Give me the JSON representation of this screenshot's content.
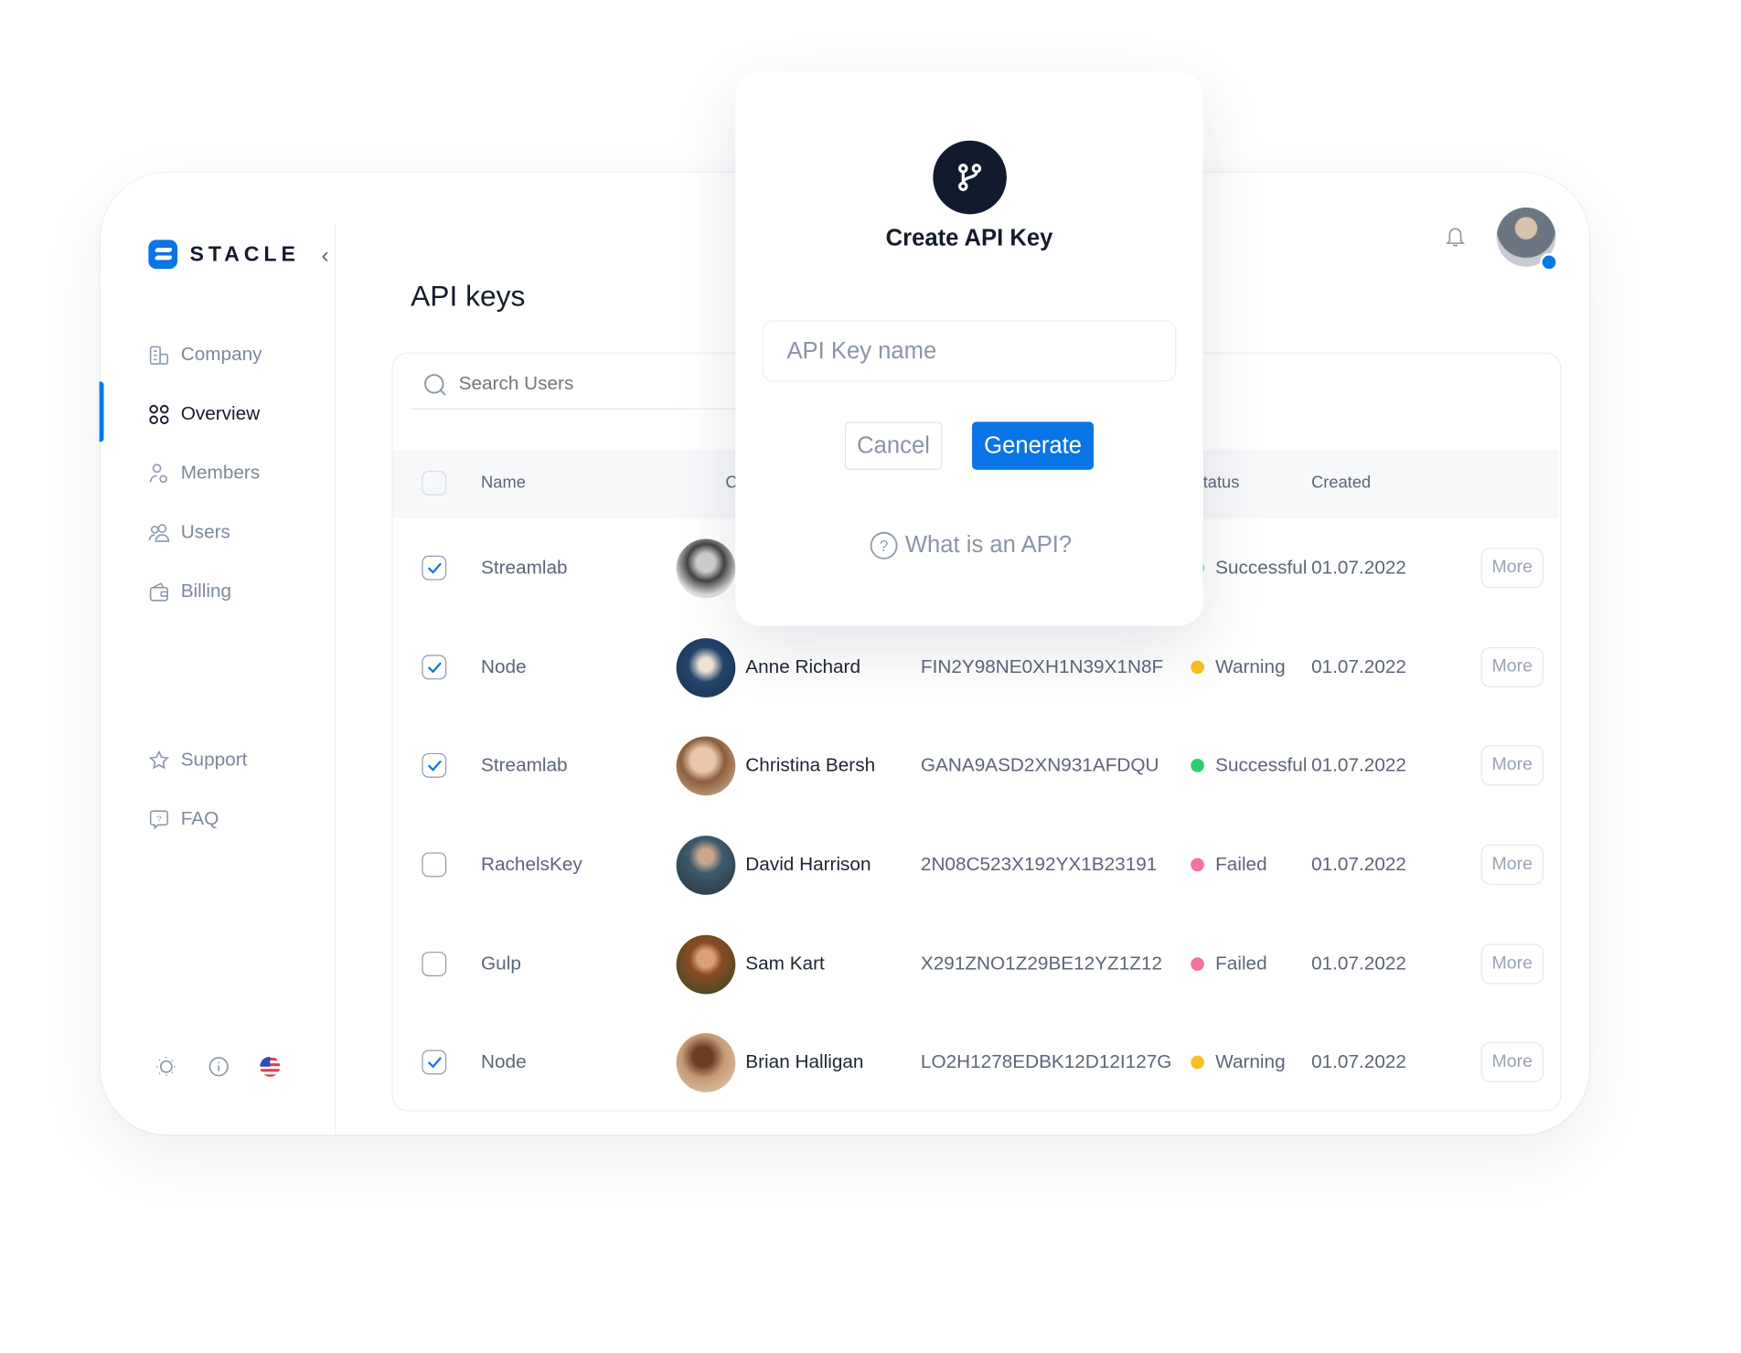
{
  "brand": {
    "name": "STACLE",
    "accent": "#0a75e6"
  },
  "sidebar": {
    "items": [
      {
        "label": "Company",
        "icon": "building-icon",
        "active": false
      },
      {
        "label": "Overview",
        "icon": "grid-icon",
        "active": true
      },
      {
        "label": "Members",
        "icon": "member-settings-icon",
        "active": false
      },
      {
        "label": "Users",
        "icon": "users-icon",
        "active": false
      },
      {
        "label": "Billing",
        "icon": "wallet-icon",
        "active": false
      }
    ],
    "secondary": [
      {
        "label": "Support",
        "icon": "star-icon"
      },
      {
        "label": "FAQ",
        "icon": "question-bubble-icon"
      }
    ],
    "footer_icons": [
      "sun-icon",
      "info-icon",
      "us-flag-icon"
    ]
  },
  "page": {
    "title": "API keys"
  },
  "header": {
    "icons": [
      "bell-icon",
      "avatar"
    ]
  },
  "search": {
    "placeholder": "Search Users"
  },
  "table": {
    "columns": {
      "name": "Name",
      "c": "C",
      "status": "Status",
      "created": "Created"
    },
    "rows": [
      {
        "checked": true,
        "name": "Streamlab",
        "owner": "",
        "key": "",
        "status": "Successful",
        "status_color": "#2ecc71",
        "created": "01.07.2022",
        "action": "More"
      },
      {
        "checked": true,
        "name": "Node",
        "owner": "Anne Richard",
        "key": "FIN2Y98NE0XH1N39X1N8F",
        "status": "Warning",
        "status_color": "#fbbf24",
        "created": "01.07.2022",
        "action": "More"
      },
      {
        "checked": true,
        "name": "Streamlab",
        "owner": "Christina Bersh",
        "key": "GANA9ASD2XN931AFDQU",
        "status": "Successful",
        "status_color": "#2ecc71",
        "created": "01.07.2022",
        "action": "More"
      },
      {
        "checked": false,
        "name": "RachelsKey",
        "owner": "David Harrison",
        "key": "2N08C523X192YX1B23191",
        "status": "Failed",
        "status_color": "#f472a0",
        "created": "01.07.2022",
        "action": "More"
      },
      {
        "checked": false,
        "name": "Gulp",
        "owner": "Sam Kart",
        "key": "X291ZNO1Z29BE12YZ1Z12",
        "status": "Failed",
        "status_color": "#f472a0",
        "created": "01.07.2022",
        "action": "More"
      },
      {
        "checked": true,
        "name": "Node",
        "owner": "Brian Halligan",
        "key": "LO2H1278EDBK12D12I127G",
        "status": "Warning",
        "status_color": "#fbbf24",
        "created": "01.07.2022",
        "action": "More"
      }
    ]
  },
  "modal": {
    "icon": "git-branch-icon",
    "title": "Create API Key",
    "input_placeholder": "API Key name",
    "cancel_label": "Cancel",
    "generate_label": "Generate",
    "help_label": "What is an API?"
  }
}
